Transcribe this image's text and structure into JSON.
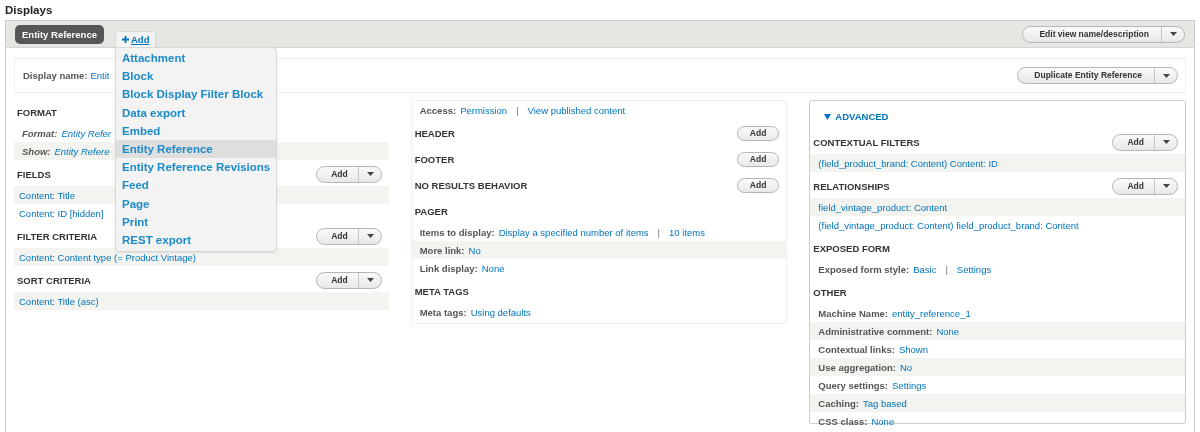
{
  "page_title": "Displays",
  "link_separator": "|",
  "tabs": [
    {
      "label": "Entity Reference",
      "selected": true
    }
  ],
  "add_link": {
    "label": "Add",
    "expanded": true
  },
  "add_menu": [
    {
      "label": "Attachment",
      "selected": false
    },
    {
      "label": "Block",
      "selected": false
    },
    {
      "label": "Block Display Filter Block",
      "selected": false
    },
    {
      "label": "Data export",
      "selected": false
    },
    {
      "label": "Embed",
      "selected": false
    },
    {
      "label": "Entity Reference",
      "selected": true
    },
    {
      "label": "Entity Reference Revisions",
      "selected": false
    },
    {
      "label": "Feed",
      "selected": false
    },
    {
      "label": "Page",
      "selected": false
    },
    {
      "label": "Print",
      "selected": false
    },
    {
      "label": "REST export",
      "selected": false
    }
  ],
  "edit_button": {
    "label": "Edit view name/description"
  },
  "display_name": {
    "label": "Display name:",
    "value": "Entit"
  },
  "duplicate_button": {
    "label": "Duplicate Entity Reference"
  },
  "columns": [
    {
      "sections": [
        {
          "title": "FORMAT",
          "rows": [
            {
              "label": "Format:",
              "links": [
                "Entity Refer"
              ],
              "italic": true,
              "shaded": false
            },
            {
              "label": "Show:",
              "links": [
                "Entity Refere"
              ],
              "italic": true,
              "shaded": true
            }
          ]
        },
        {
          "title": "FIELDS",
          "button": {
            "kind": "split",
            "label": "Add"
          },
          "rows": [
            {
              "links": [
                "Content: Title"
              ],
              "italic": false,
              "shaded": true
            },
            {
              "links": [
                "Content: ID [hidden]"
              ],
              "italic": false,
              "shaded": false
            }
          ]
        },
        {
          "title": "FILTER CRITERIA",
          "button": {
            "kind": "split",
            "label": "Add"
          },
          "rows": [
            {
              "links": [
                "Content: Content type (= Product Vintage)"
              ],
              "italic": false,
              "shaded": true
            }
          ]
        },
        {
          "title": "SORT CRITERIA",
          "button": {
            "kind": "split",
            "label": "Add"
          },
          "rows": [
            {
              "links": [
                "Content: Title (asc)"
              ],
              "italic": false,
              "shaded": true
            }
          ]
        }
      ]
    },
    {
      "sections": [
        {
          "rows": [
            {
              "label": "Access:",
              "links": [
                "Permission",
                "View published content"
              ],
              "italic": false,
              "shaded": false
            }
          ]
        },
        {
          "title": "HEADER",
          "button": {
            "kind": "plain",
            "label": "Add"
          }
        },
        {
          "title": "FOOTER",
          "button": {
            "kind": "plain",
            "label": "Add"
          }
        },
        {
          "title": "NO RESULTS BEHAVIOR",
          "button": {
            "kind": "plain",
            "label": "Add"
          }
        },
        {
          "title": "PAGER",
          "rows": [
            {
              "label": "Items to display:",
              "links": [
                "Display a specified number of items",
                "10 items"
              ],
              "italic": false,
              "shaded": false
            },
            {
              "label": "More link:",
              "links": [
                "No"
              ],
              "italic": false,
              "shaded": true
            },
            {
              "label": "Link display:",
              "links": [
                "None"
              ],
              "italic": false,
              "shaded": false
            }
          ]
        },
        {
          "title": "META TAGS",
          "rows": [
            {
              "label": "Meta tags:",
              "links": [
                "Using defaults"
              ],
              "italic": false,
              "shaded": false
            }
          ]
        }
      ]
    },
    {
      "toggle": {
        "label": "ADVANCED",
        "expanded": true
      },
      "sections": [
        {
          "title": "CONTEXTUAL FILTERS",
          "button": {
            "kind": "split",
            "label": "Add"
          },
          "rows": [
            {
              "links": [
                "(field_product_brand: Content) Content: ID"
              ],
              "italic": false,
              "shaded": true
            }
          ]
        },
        {
          "title": "RELATIONSHIPS",
          "button": {
            "kind": "split",
            "label": "Add"
          },
          "rows": [
            {
              "links": [
                "field_vintage_product: Content"
              ],
              "italic": false,
              "shaded": true
            },
            {
              "links": [
                "(field_vintage_product: Content) field_product_brand: Content"
              ],
              "italic": false,
              "shaded": false
            }
          ]
        },
        {
          "title": "EXPOSED FORM",
          "rows": [
            {
              "label": "Exposed form style:",
              "links": [
                "Basic",
                "Settings"
              ],
              "italic": false,
              "shaded": false
            }
          ]
        },
        {
          "title": "OTHER",
          "rows": [
            {
              "label": "Machine Name:",
              "links": [
                "entity_reference_1"
              ],
              "italic": false,
              "shaded": false
            },
            {
              "label": "Administrative comment:",
              "links": [
                "None"
              ],
              "italic": false,
              "shaded": true
            },
            {
              "label": "Contextual links:",
              "links": [
                "Shown"
              ],
              "italic": false,
              "shaded": false
            },
            {
              "label": "Use aggregation:",
              "links": [
                "No"
              ],
              "italic": false,
              "shaded": true
            },
            {
              "label": "Query settings:",
              "links": [
                "Settings"
              ],
              "italic": false,
              "shaded": false
            },
            {
              "label": "Caching:",
              "links": [
                "Tag based"
              ],
              "italic": false,
              "shaded": true
            },
            {
              "label": "CSS class:",
              "links": [
                "None"
              ],
              "italic": false,
              "shaded": false
            }
          ]
        }
      ]
    }
  ]
}
